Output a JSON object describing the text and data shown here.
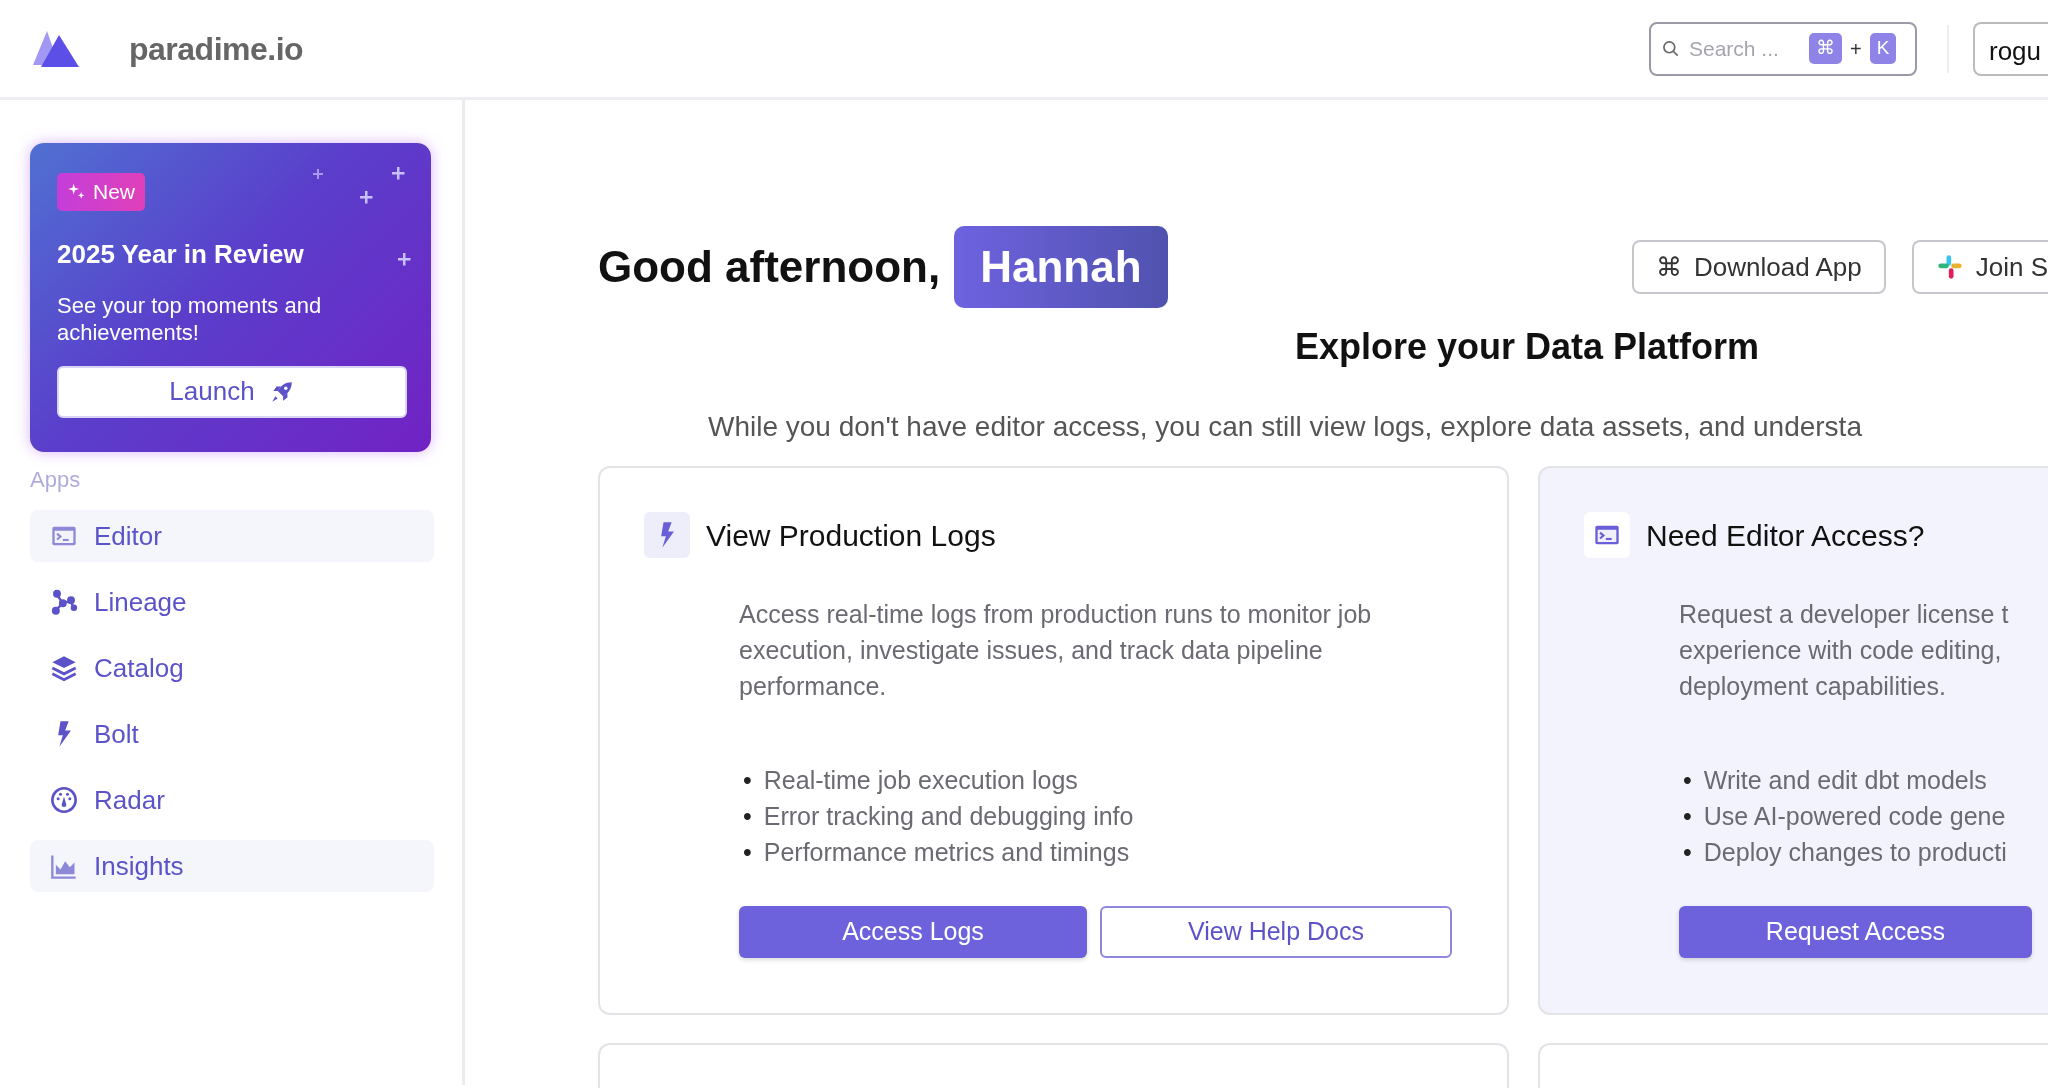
{
  "header": {
    "logo_text": "paradime.io",
    "search": {
      "placeholder": "Search ...",
      "keys": [
        "⌘",
        "K"
      ],
      "joiner": "+"
    },
    "workspace": "rogu"
  },
  "sidebar": {
    "promo": {
      "badge": "New",
      "title": "2025 Year in Review",
      "text": "See your top moments and achievements!",
      "button": "Launch"
    },
    "section": "Apps",
    "items": [
      {
        "label": "Editor",
        "highlighted": true
      },
      {
        "label": "Lineage",
        "highlighted": false
      },
      {
        "label": "Catalog",
        "highlighted": false
      },
      {
        "label": "Bolt",
        "highlighted": false
      },
      {
        "label": "Radar",
        "highlighted": false
      },
      {
        "label": "Insights",
        "highlighted": true
      }
    ]
  },
  "main": {
    "greeting": "Good afternoon,",
    "user": "Hannah",
    "actions": [
      {
        "kind": "glyph",
        "glyph": "⌘",
        "label": "Download App"
      },
      {
        "kind": "slack",
        "label": "Join S"
      }
    ],
    "title": "Explore your Data Platform",
    "subtitle": "While you don't have editor access, you can still view logs, explore data assets, and understa",
    "cards": [
      {
        "bullet": "•",
        "highlighted": false,
        "title": "View Production Logs",
        "description": "Access real-time logs from production runs to monitor job execution, investigate issues, and track data pipeline performance.",
        "bullets": [
          "Real-time job execution logs",
          "Error tracking and debugging info",
          "Performance metrics and timings"
        ],
        "buttons": [
          {
            "kind": "primary",
            "label": "Access Logs"
          },
          {
            "kind": "outline",
            "label": "View Help Docs"
          }
        ]
      },
      {
        "bullet": "•",
        "highlighted": true,
        "title": "Need Editor Access?",
        "description_lines": [
          "Request a developer license t",
          "experience with code editing,",
          "deployment capabilities."
        ],
        "bullets": [
          "Write and edit dbt models",
          "Use AI-powered code gene",
          "Deploy changes to producti"
        ],
        "buttons": [
          {
            "kind": "primary",
            "label": "Request Access"
          }
        ]
      }
    ]
  }
}
